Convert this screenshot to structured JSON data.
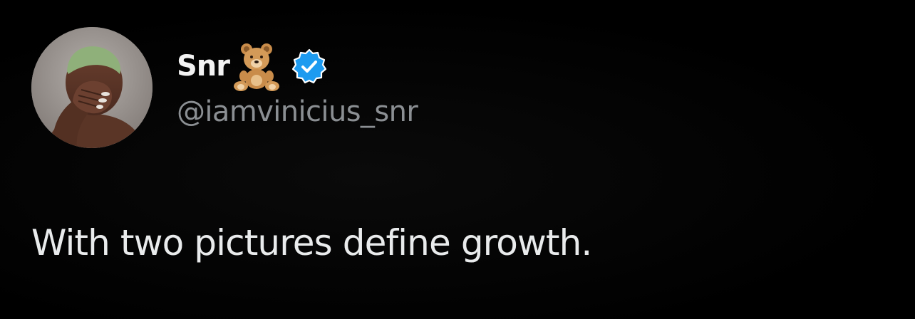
{
  "tweet": {
    "author": {
      "display_name": "Snr",
      "name_emoji": "teddy-bear-icon",
      "verified_badge": "verified-badge-icon",
      "handle": "@iamvinicius_snr",
      "avatar": "profile-photo"
    },
    "text": "With two pictures define growth."
  },
  "colors": {
    "background": "#000000",
    "text_primary": "#e7e9ea",
    "text_secondary": "#8b8f93",
    "verified_blue": "#1d9bf0"
  }
}
